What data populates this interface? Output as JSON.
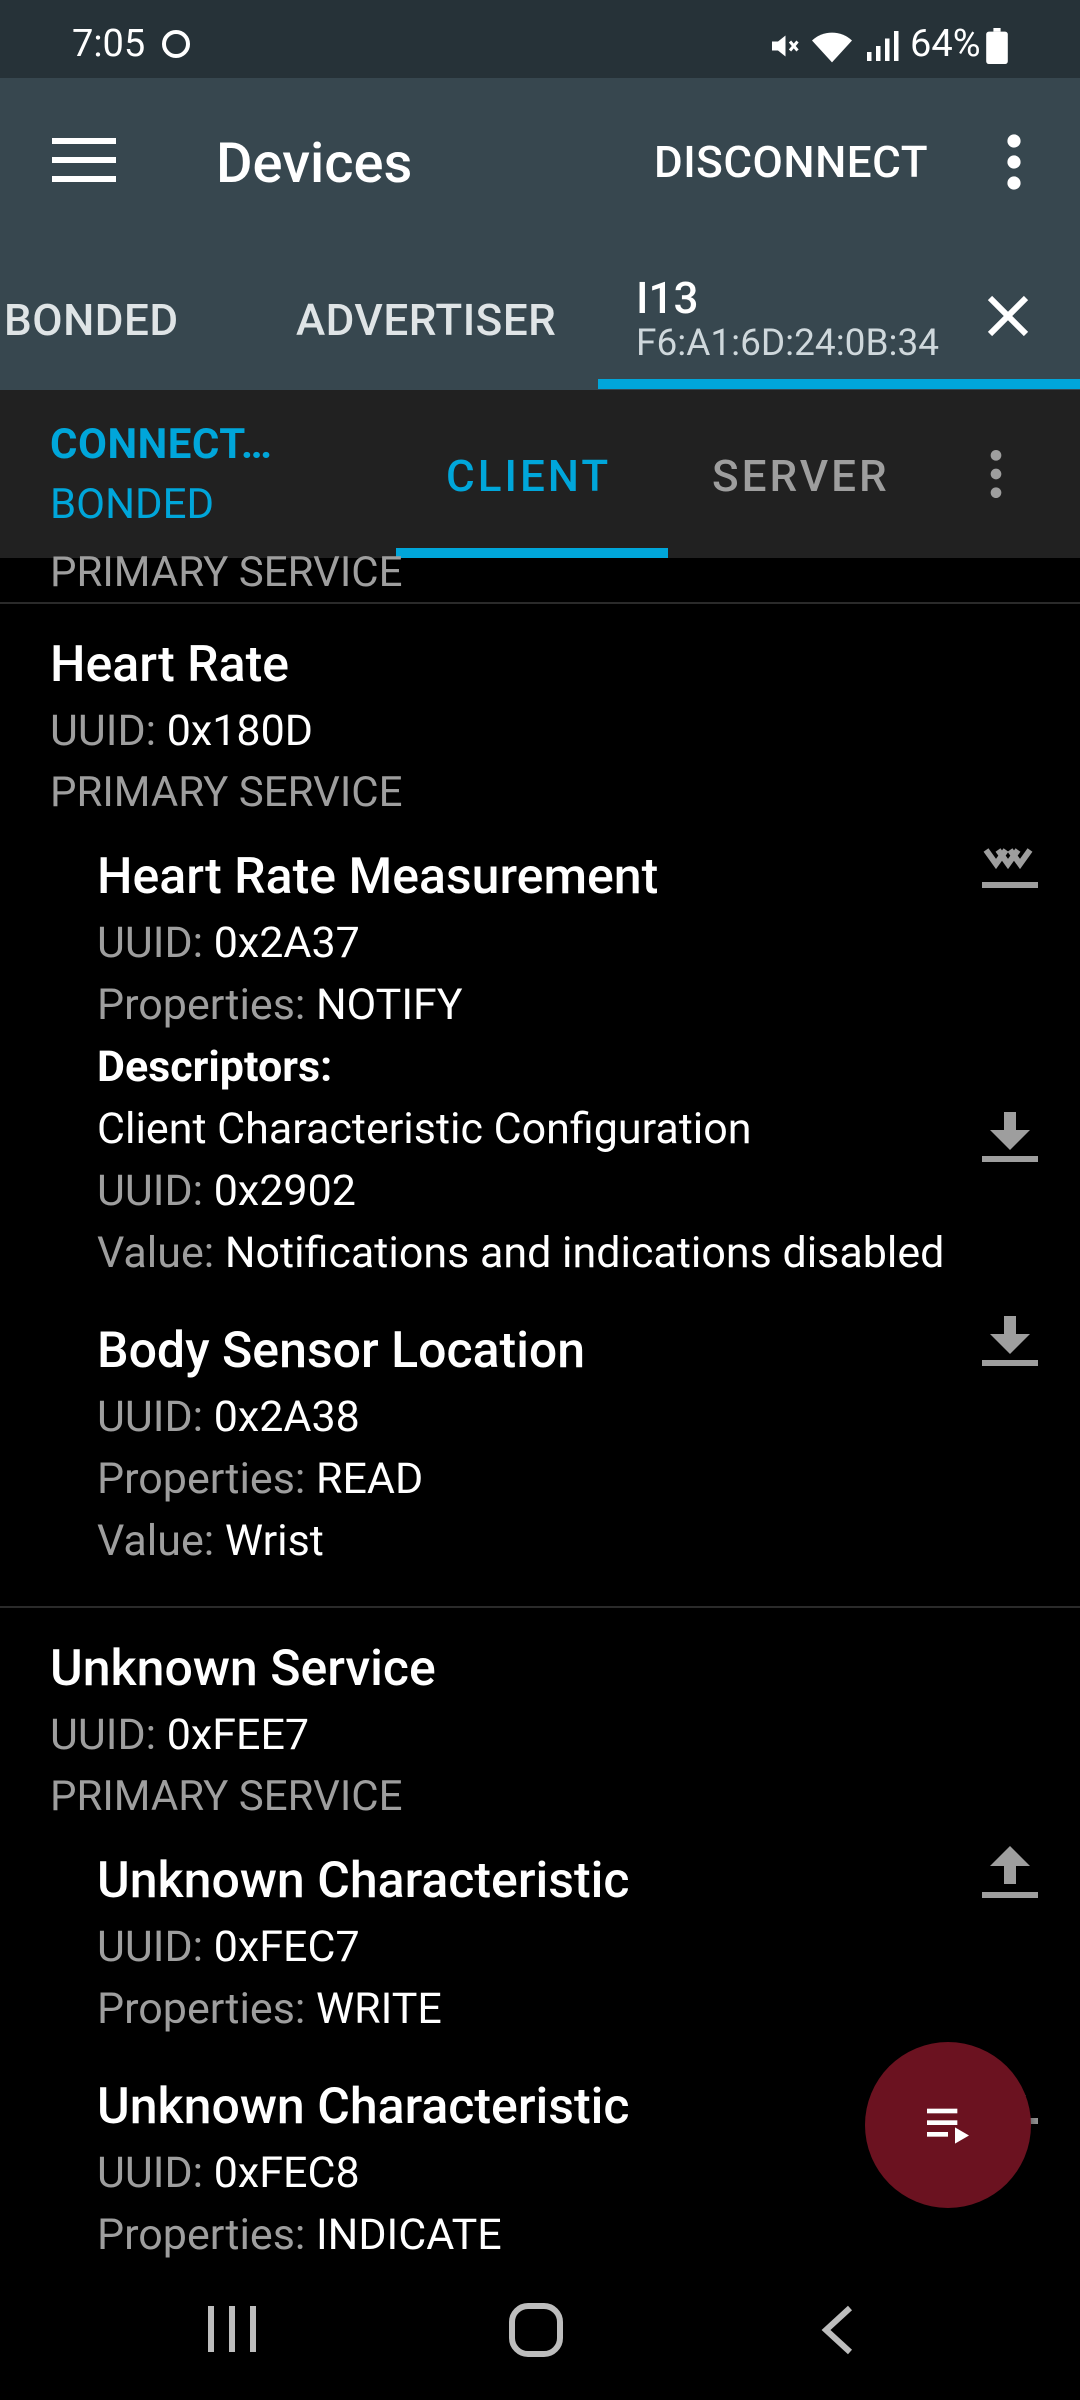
{
  "status_bar": {
    "time": "7:05",
    "battery": "64%"
  },
  "app_bar": {
    "title": "Devices",
    "disconnect_label": "DISCONNECT"
  },
  "device_tabs": {
    "tab_bonded": "BONDED",
    "tab_advertiser": "ADVERTISER",
    "selected_name": "I13",
    "selected_address": "F6:A1:6D:24:0B:34"
  },
  "connection": {
    "state": "CONNECT…",
    "bond_state": "BONDED",
    "tab_client": "CLIENT",
    "tab_server": "SERVER"
  },
  "labels": {
    "uuid": "UUID: ",
    "properties": "Properties: ",
    "value": "Value: ",
    "descriptors": "Descriptors:"
  },
  "content": {
    "partial_header": "PRIMARY SERVICE",
    "services": [
      {
        "name": "Heart Rate",
        "uuid": "0x180D",
        "type": "PRIMARY SERVICE",
        "characteristics": [
          {
            "name": "Heart Rate Measurement",
            "uuid": "0x2A37",
            "properties": "NOTIFY",
            "descriptor": {
              "name": "Client Characteristic Configuration",
              "uuid": "0x2902",
              "value": "Notifications and indications disabled"
            }
          },
          {
            "name": "Body Sensor Location",
            "uuid": "0x2A38",
            "properties": "READ",
            "value": "Wrist"
          }
        ]
      },
      {
        "name": "Unknown Service",
        "uuid": "0xFEE7",
        "type": "PRIMARY SERVICE",
        "characteristics": [
          {
            "name": "Unknown Characteristic",
            "uuid": "0xFEC7",
            "properties": "WRITE"
          },
          {
            "name": "Unknown Characteristic",
            "uuid": "0xFEC8",
            "properties": "INDICATE"
          }
        ]
      }
    ]
  },
  "colors": {
    "accent": "#00a6da",
    "app_bar": "#37474f",
    "fab": "#6b1220"
  }
}
